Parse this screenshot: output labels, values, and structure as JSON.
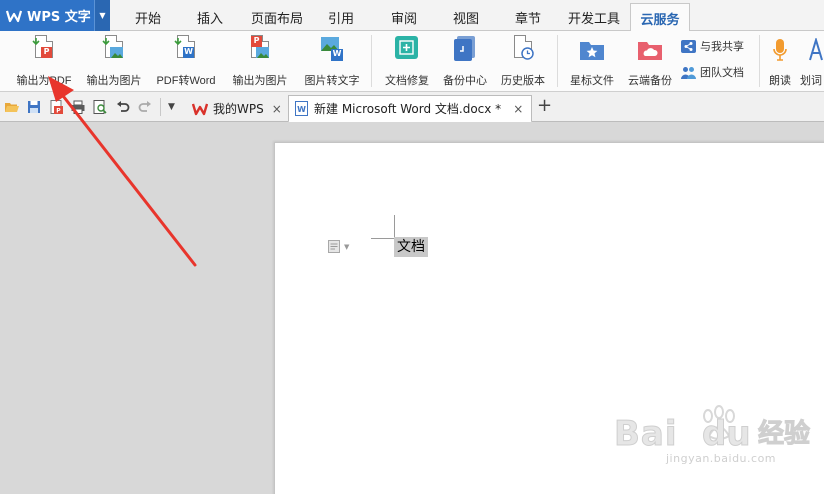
{
  "app": {
    "title": "WPS 文字",
    "accent": "#2f73c7"
  },
  "menu_tabs": [
    {
      "label": "开始"
    },
    {
      "label": "插入"
    },
    {
      "label": "页面布局"
    },
    {
      "label": "引用"
    },
    {
      "label": "审阅"
    },
    {
      "label": "视图"
    },
    {
      "label": "章节"
    },
    {
      "label": "开发工具"
    },
    {
      "label": "云服务",
      "active": true
    }
  ],
  "ribbon": {
    "export_pdf": "输出为PDF",
    "export_image": "输出为图片",
    "pdf_to_word": "PDF转Word",
    "export_image_2": "输出为图片",
    "image_to_text": "图片转文字",
    "doc_repair": "文档修复",
    "backup_center": "备份中心",
    "history": "历史版本",
    "starred": "星标文件",
    "cloud_backup": "云端备份",
    "shared_with_me": "与我共享",
    "team_docs": "团队文档",
    "read_aloud": "朗读",
    "highlight": "划词"
  },
  "doc_tabs": [
    {
      "label": "我的WPS",
      "close": "×"
    },
    {
      "label": "新建 Microsoft Word 文档.docx *",
      "close": "×",
      "active": true
    }
  ],
  "new_tab_symbol": "+",
  "document": {
    "selected_text": "文档"
  },
  "watermark": {
    "brand": "Bai",
    "brand_tail": "du",
    "cn": "经验",
    "url": "jingyan.baidu.com"
  },
  "annotation": {
    "arrow_color": "#e8352c",
    "points_to": "export-pdf-button"
  }
}
